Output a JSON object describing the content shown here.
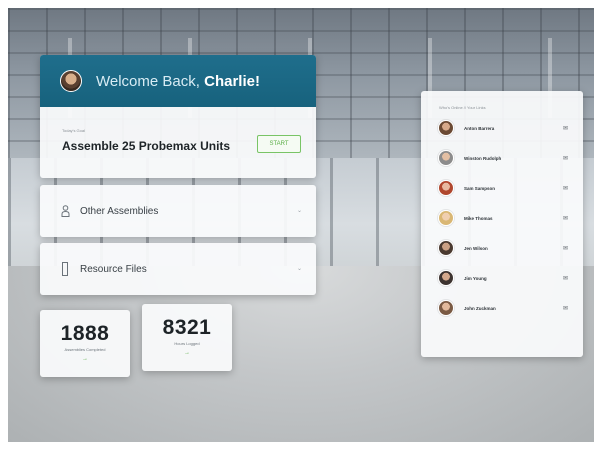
{
  "welcome": {
    "greeting": "Welcome Back,",
    "name": "Charlie!",
    "task_label": "Today's Goal",
    "task_title": "Assemble 25 Probemax Units",
    "start_label": "START"
  },
  "panels": {
    "assemblies_label": "Other Assemblies",
    "resources_label": "Resource Files",
    "caret": "⌄"
  },
  "stats": [
    {
      "value": "1888",
      "label": "Assemblies Completed",
      "arrow": "→"
    },
    {
      "value": "8321",
      "label": "Hours Logged",
      "arrow": "→"
    }
  ],
  "team": {
    "title": "Who's Online // Your Links",
    "members": [
      {
        "name": "Anton Barrera",
        "icon": "✉"
      },
      {
        "name": "Winston Rudolph",
        "icon": "✉"
      },
      {
        "name": "Sam Sampson",
        "icon": "✉"
      },
      {
        "name": "Mike Thomas",
        "icon": "✉"
      },
      {
        "name": "Jen Wilson",
        "icon": "✉"
      },
      {
        "name": "Jim Young",
        "icon": "✉"
      },
      {
        "name": "John Zuckman",
        "icon": "✉"
      }
    ]
  },
  "colors": {
    "header": "#1f6e8c",
    "accent_green": "#5aae46"
  }
}
